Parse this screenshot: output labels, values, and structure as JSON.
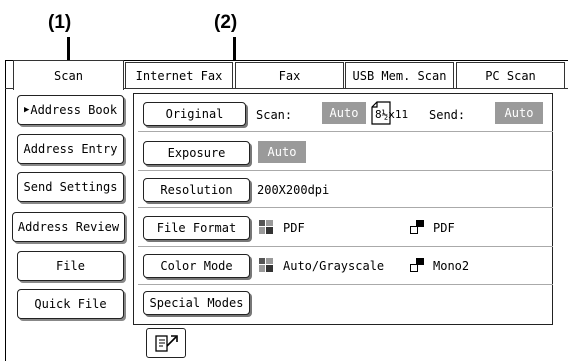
{
  "callouts": [
    "(1)",
    "(2)"
  ],
  "tabs": [
    "Scan",
    "Internet Fax",
    "Fax",
    "USB Mem. Scan",
    "PC Scan"
  ],
  "sidebar": [
    "Address Book",
    "Address Entry",
    "Send Settings",
    "Address Review",
    "File",
    "Quick File"
  ],
  "original": {
    "button": "Original",
    "scan_label": "Scan:",
    "scan_value": "Auto",
    "paper": "8½x11",
    "send_label": "Send:",
    "send_value": "Auto"
  },
  "exposure": {
    "button": "Exposure",
    "value": "Auto"
  },
  "resolution": {
    "button": "Resolution",
    "value": "200X200dpi"
  },
  "file_format": {
    "button": "File Format",
    "color_value": "PDF",
    "mono_value": "PDF"
  },
  "color_mode": {
    "button": "Color Mode",
    "color_value": "Auto/Grayscale",
    "mono_value": "Mono2"
  },
  "special_modes": {
    "button": "Special Modes"
  },
  "icons": {
    "bottom": "scan-preview-icon",
    "color": "color-squares-icon",
    "mono": "mono-squares-icon"
  }
}
